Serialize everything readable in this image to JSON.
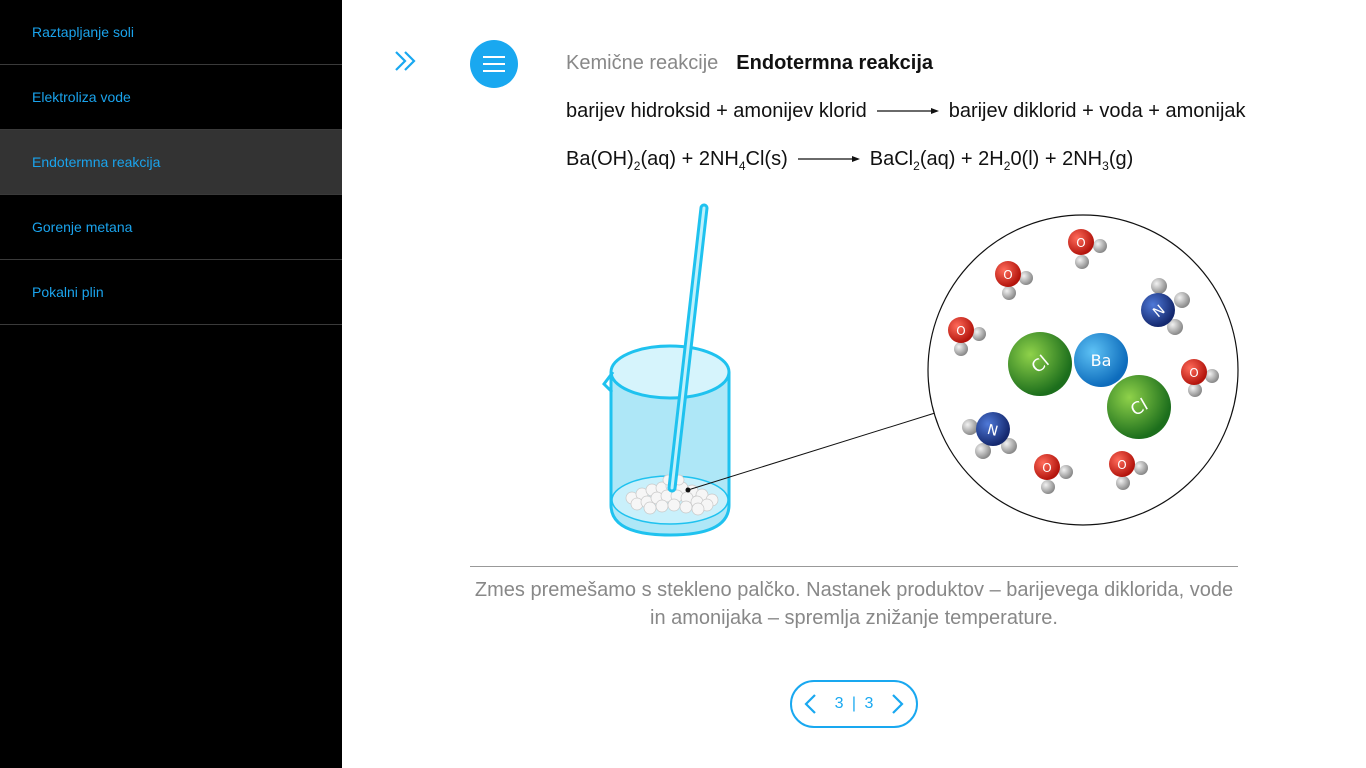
{
  "sidebar": {
    "items": [
      {
        "label": "Raztapljanje soli"
      },
      {
        "label": "Elektroliza vode"
      },
      {
        "label": "Endotermna reakcija"
      },
      {
        "label": "Gorenje metana"
      },
      {
        "label": "Pokalni plin"
      }
    ]
  },
  "breadcrumb": {
    "category": "Kemične reakcije",
    "current": "Endotermna reakcija"
  },
  "equation_words": {
    "reactants": "barijev hidroksid + amonijev klorid",
    "products": "barijev diklorid + voda + amonijak"
  },
  "equation_formula": {
    "r1": "Ba(OH)",
    "s1": "2",
    "r2": "(aq) + 2NH",
    "s2": "4",
    "r3": "Cl(s)",
    "p1": "BaCl",
    "s3": "2",
    "p2": "(aq) + 2H",
    "s4": "2",
    "p3": "0(l) + 2NH",
    "s5": "3",
    "p4": "(g)"
  },
  "caption": "Zmes premešamo s stekleno palčko. Nastanek produktov – barijevega diklorida, vode in amonijaka – spremlja znižanje temperature.",
  "pager": {
    "current": "3",
    "divider": "|",
    "total": "3"
  },
  "molecule_labels": {
    "ba": "Ba",
    "cl": "Cl",
    "n": "N",
    "o": "O"
  },
  "colors": {
    "accent": "#19a8f0",
    "sidebar_bg": "#000000",
    "sidebar_text": "#1aa3ec",
    "active_bg": "#333333"
  }
}
